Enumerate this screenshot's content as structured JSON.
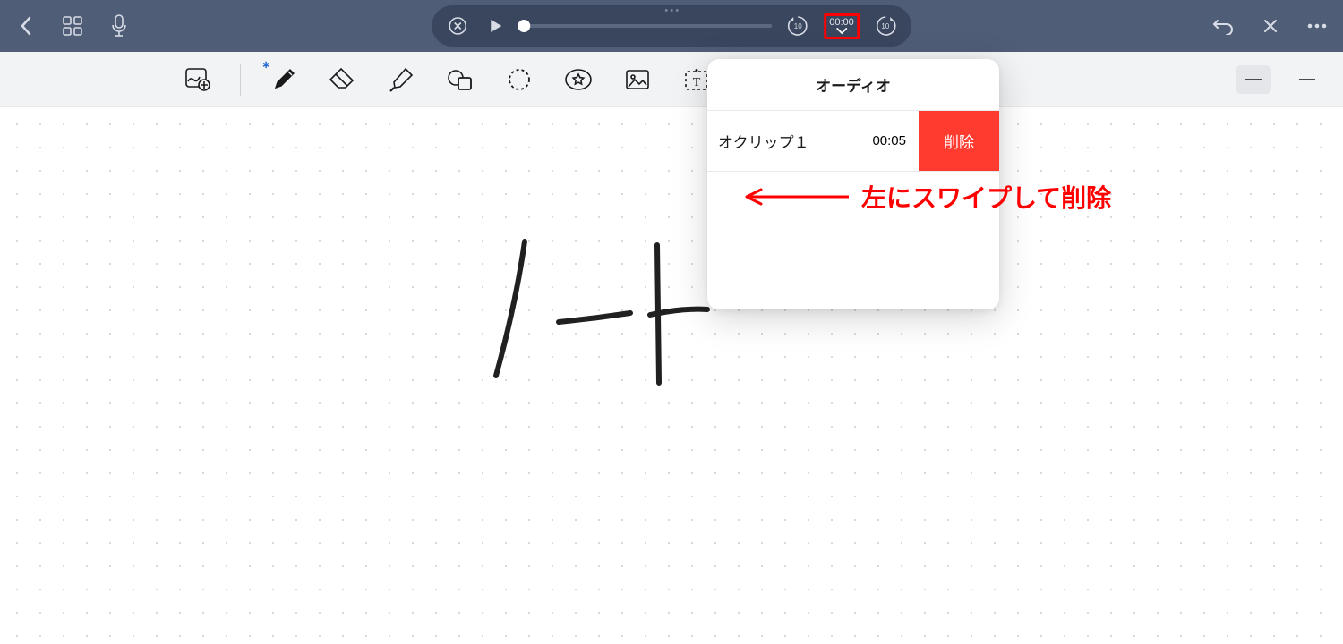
{
  "topbar": {
    "playback": {
      "time": "00:00",
      "skip_amount": "10"
    }
  },
  "popover": {
    "title": "オーディオ",
    "clip": {
      "name": "オクリップ１",
      "duration": "00:05",
      "delete_label": "削除"
    }
  },
  "annotation": {
    "text": "左にスワイプして削除"
  },
  "handwriting": {
    "text": "ノート"
  },
  "icons": {
    "back": "back-chevron",
    "grid": "apps-grid",
    "mic": "microphone",
    "close_circle": "close-circle",
    "play": "play-triangle",
    "skip_back": "skip-back-10",
    "skip_fwd": "skip-forward-10",
    "undo": "undo-arrow",
    "scissors": "scissors-x",
    "more": "ellipsis",
    "addnote": "add-note",
    "pen": "pen",
    "eraser": "eraser",
    "highlighter": "highlighter",
    "shapes": "shapes",
    "lasso": "lasso-select",
    "favorites": "star-bubble",
    "image": "image",
    "text": "text-box"
  }
}
